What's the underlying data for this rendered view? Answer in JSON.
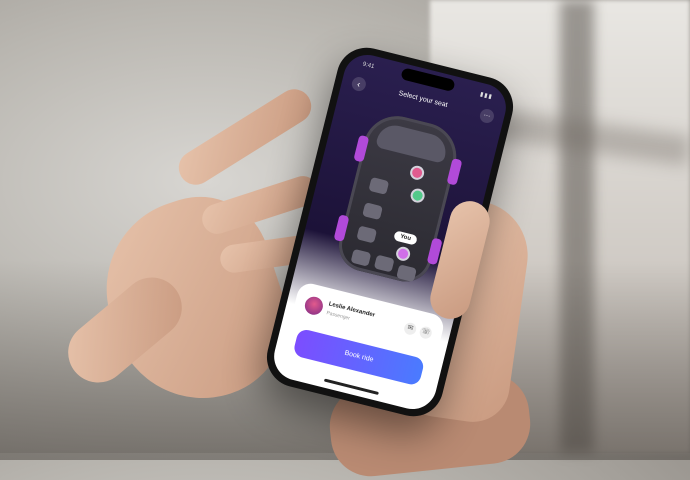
{
  "status": {
    "time": "9:41",
    "signal": "▮▮▮"
  },
  "header": {
    "title": "Select your seat",
    "back_icon": "arrow-left-icon",
    "more_icon": "ellipsis-icon"
  },
  "car": {
    "you_label": "You"
  },
  "card": {
    "driver_name": "Leslie Alexander",
    "driver_subtitle": "Passenger",
    "chat_icon": "chat-icon",
    "call_icon": "phone-icon",
    "book_label": "Book ride"
  },
  "colors": {
    "accent_start": "#7c4dff",
    "accent_end": "#4a7bff",
    "wheel": "#b14ad9",
    "screen_bg": "#1c1238"
  }
}
